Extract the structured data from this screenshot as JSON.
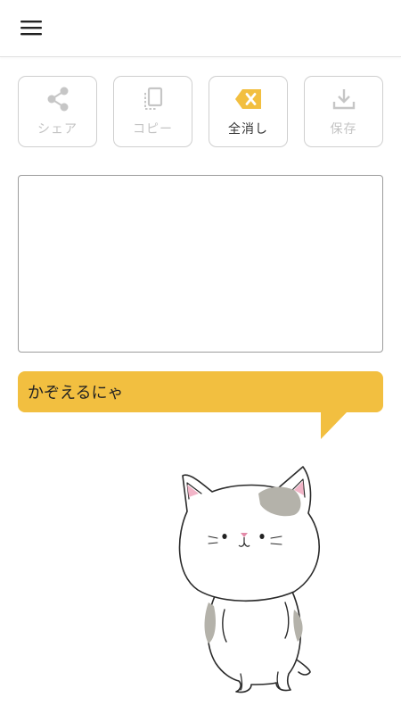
{
  "header": {
    "menu_icon": "hamburger-menu-icon"
  },
  "toolbar": {
    "buttons": [
      {
        "label": "シェア",
        "icon": "share-icon",
        "enabled": false
      },
      {
        "label": "コピー",
        "icon": "copy-icon",
        "enabled": false
      },
      {
        "label": "全消し",
        "icon": "backspace-clear-icon",
        "enabled": true
      },
      {
        "label": "保存",
        "icon": "download-save-icon",
        "enabled": false
      }
    ],
    "accent_color": "#f2bf40",
    "disabled_color": "#c4c4c4"
  },
  "editor": {
    "value": "",
    "placeholder": ""
  },
  "speech_bubble": {
    "text": "かぞえるにゃ",
    "color": "#f2bf40"
  },
  "mascot": {
    "description_icon": "cat-mascot-illustration"
  }
}
